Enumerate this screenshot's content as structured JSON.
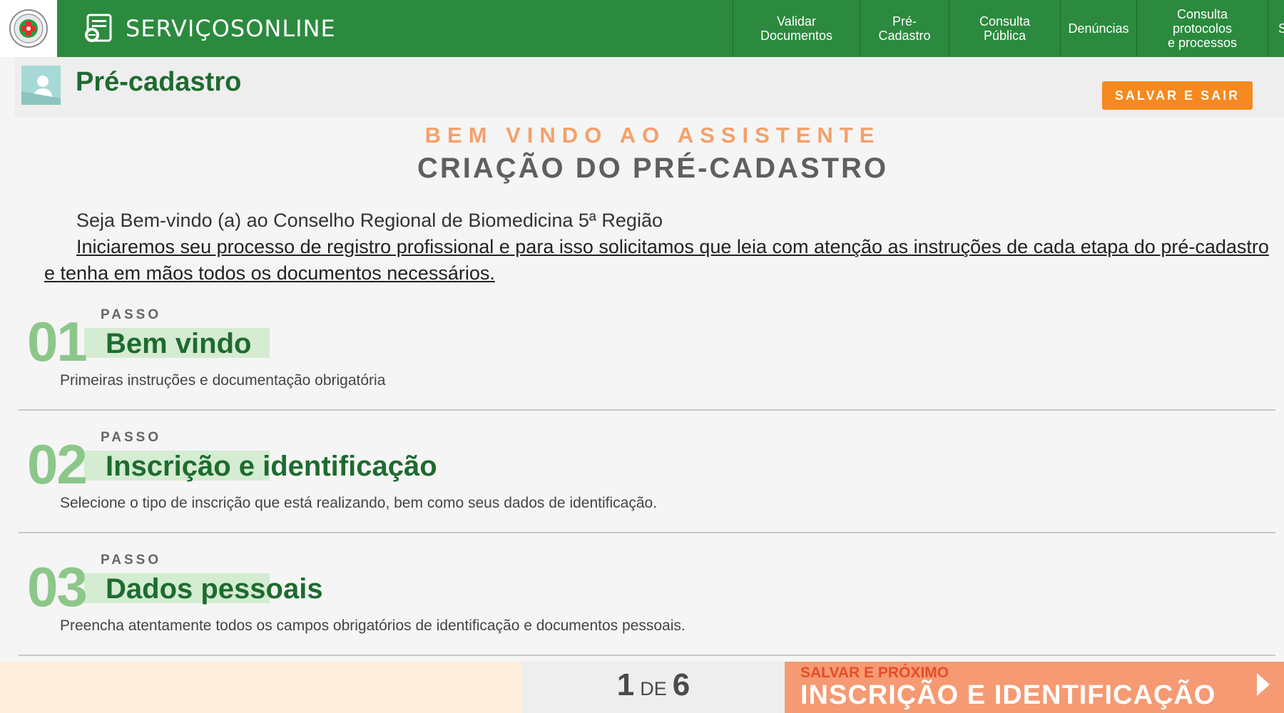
{
  "header": {
    "brand": "SERVIÇOSONLINE",
    "logo_icon": "crbm-seal-icon",
    "nav": [
      {
        "label": "Validar Documentos"
      },
      {
        "label": "Pré-Cadastro"
      },
      {
        "label": "Consulta Pública"
      },
      {
        "label": "Denúncias"
      },
      {
        "label_line1": "Consulta protocolos",
        "label_line2": "e processos"
      },
      {
        "label": "S"
      }
    ]
  },
  "page": {
    "title": "Pré-cadastro",
    "save_exit": "SALVAR E SAIR"
  },
  "welcome": {
    "kicker": "BEM VINDO AO ASSISTENTE",
    "title": "CRIAÇÃO DO PRÉ-CADASTRO",
    "intro_1": "Seja Bem-vindo (a) ao Conselho Regional de Biomedicina 5ª Região",
    "intro_2": "Iniciaremos seu processo de registro profissional e para isso solicitamos que leia com atenção as instruções de cada etapa do pré-cadastro e tenha em mãos todos os documentos necessários."
  },
  "steps": [
    {
      "number": "01",
      "kicker": "PASSO",
      "title": "Bem vindo",
      "description": "Primeiras instruções e documentação obrigatória"
    },
    {
      "number": "02",
      "kicker": "PASSO",
      "title": "Inscrição e identificação",
      "description": "Selecione o tipo de inscrição que está realizando, bem como seus dados de identificação."
    },
    {
      "number": "03",
      "kicker": "PASSO",
      "title": "Dados pessoais",
      "description": "Preencha atentamente todos os campos obrigatórios de identificação e documentos pessoais."
    }
  ],
  "footer": {
    "current": "1",
    "of": "DE",
    "total": "6",
    "next_kicker": "SALVAR E PRÓXIMO",
    "next_title": "INSCRIÇÃO E IDENTIFICAÇÃO"
  },
  "colors": {
    "header_green": "#2b8a3e",
    "title_green": "#1e6b2f",
    "step_number_green": "#8cc78a",
    "accent_orange": "#f6891f",
    "next_button": "#f59a72"
  }
}
